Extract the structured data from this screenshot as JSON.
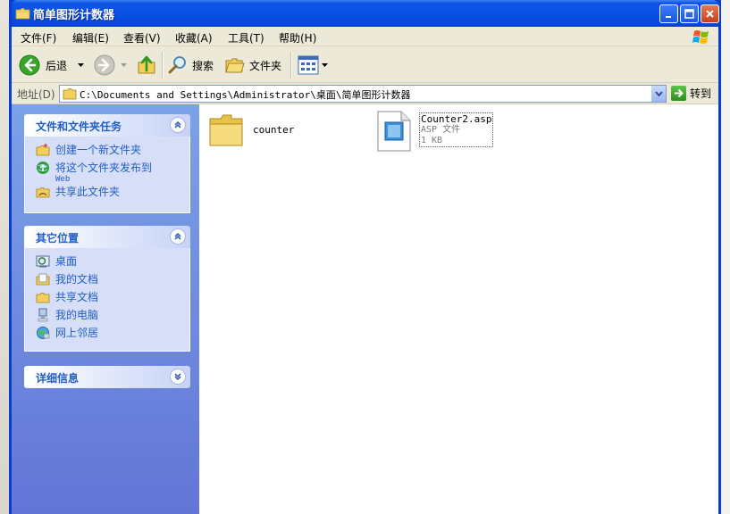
{
  "window": {
    "title": "简单图形计数器"
  },
  "menubar": {
    "items": [
      {
        "label": "文件(F)"
      },
      {
        "label": "编辑(E)"
      },
      {
        "label": "查看(V)"
      },
      {
        "label": "收藏(A)"
      },
      {
        "label": "工具(T)"
      },
      {
        "label": "帮助(H)"
      }
    ]
  },
  "toolbar": {
    "back_label": "后退",
    "search_label": "搜索",
    "folders_label": "文件夹"
  },
  "address": {
    "label": "地址(D)",
    "path": "C:\\Documents and Settings\\Administrator\\桌面\\简单图形计数器",
    "go_label": "转到"
  },
  "sidebar": {
    "tasks": {
      "title": "文件和文件夹任务",
      "items": [
        {
          "label": "创建一个新文件夹"
        },
        {
          "label": "将这个文件夹发布到",
          "sub": "Web"
        },
        {
          "label": "共享此文件夹"
        }
      ]
    },
    "places": {
      "title": "其它位置",
      "items": [
        {
          "label": "桌面"
        },
        {
          "label": "我的文档"
        },
        {
          "label": "共享文档"
        },
        {
          "label": "我的电脑"
        },
        {
          "label": "网上邻居"
        }
      ]
    },
    "details": {
      "title": "详细信息"
    }
  },
  "files": [
    {
      "name": "counter"
    },
    {
      "name": "Counter2.asp",
      "type": "ASP 文件",
      "size": "1 KB"
    }
  ],
  "colors": {
    "titlebar": "#0752e4",
    "sidebar_top": "#7ba2e7",
    "sidebar_bottom": "#6375d6",
    "panel_title": "#215dc6",
    "panel_body": "#d6dff7"
  }
}
